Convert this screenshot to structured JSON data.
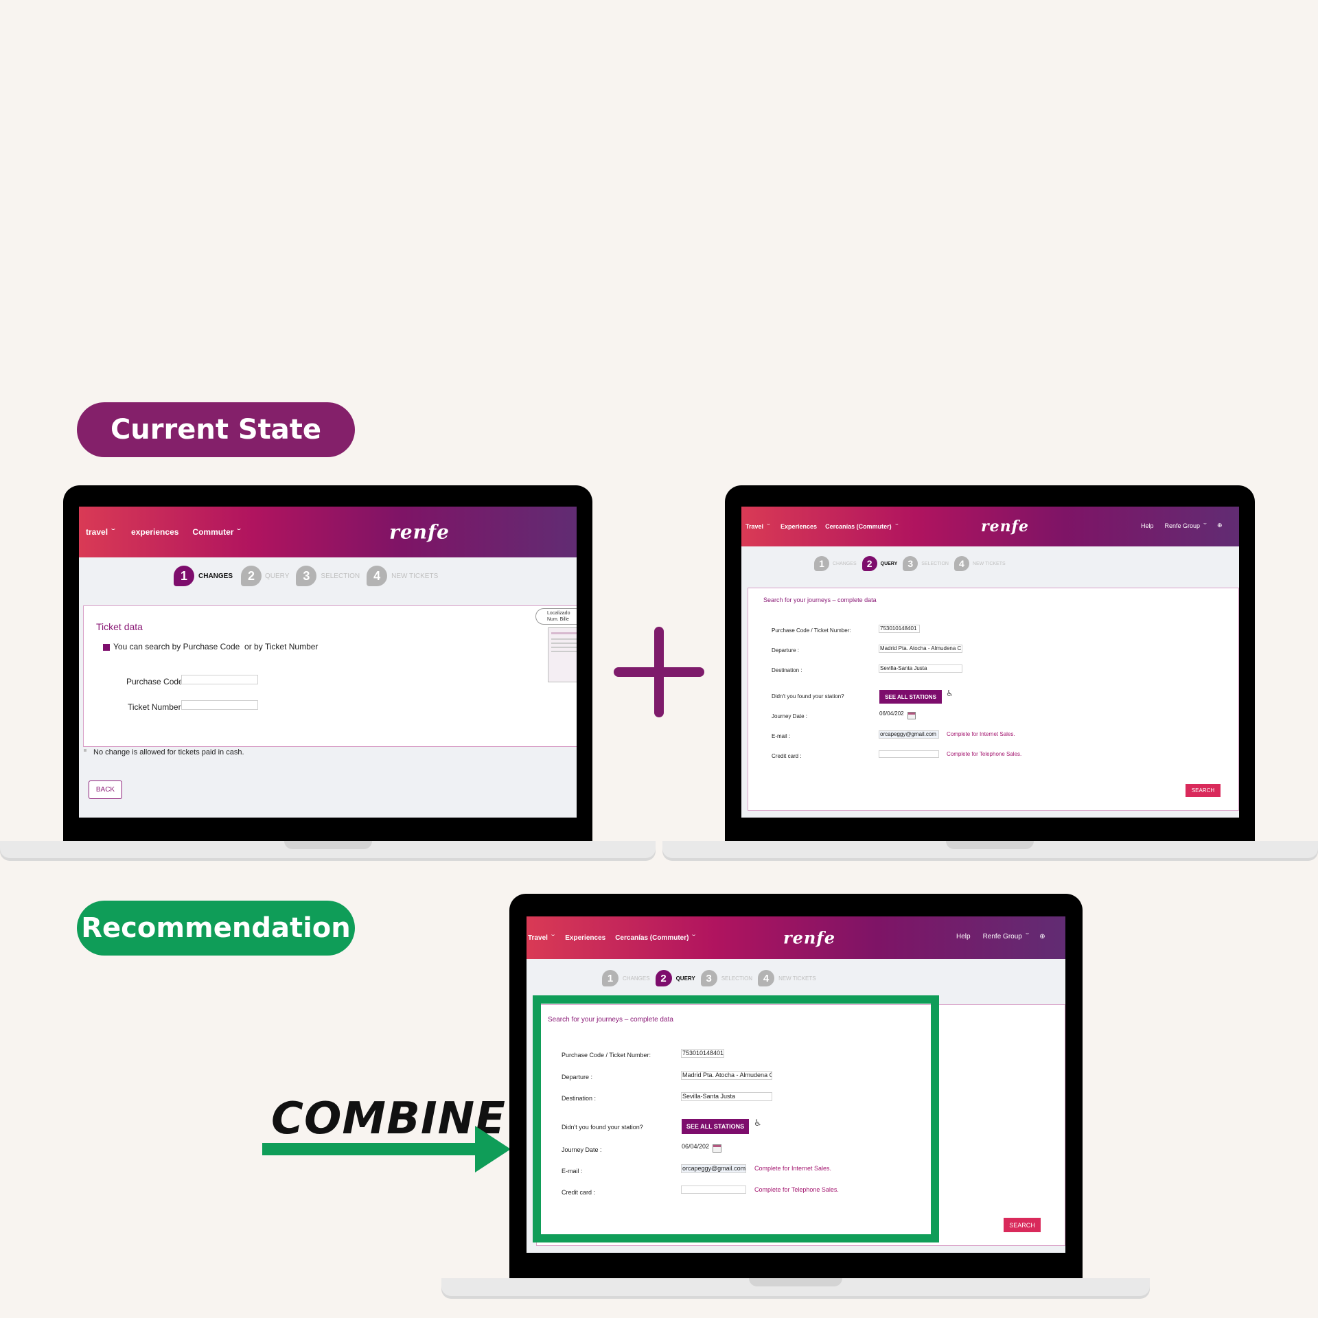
{
  "labels": {
    "current_state": "Current State",
    "recommendation": "Recommendation",
    "combine": "COMBINE"
  },
  "colors": {
    "background": "#f8f4f0",
    "current_pill": "#84206a",
    "recommendation_pill": "#0f9d58",
    "plus": "#7e1b6b",
    "arrow": "#0f9d58",
    "highlight": "#0f9d58",
    "renfe_purple": "#7d0d6c",
    "search_red": "#d92a5b"
  },
  "icons": {
    "plus": "plus-icon",
    "arrow": "right-arrow-icon",
    "calendar": "calendar-icon",
    "wheelchair": "wheelchair-icon",
    "globe": "globe-icon"
  },
  "screen1": {
    "nav": {
      "travel": "travel",
      "experiences": "experiences",
      "commuter": "Commuter",
      "logo": "renfe"
    },
    "steps": [
      "CHANGES",
      "QUERY",
      "SELECTION",
      "NEW TICKETS"
    ],
    "step_numbers": [
      "1",
      "2",
      "3",
      "4"
    ],
    "active_step": 1,
    "ticket_data_title": "Ticket data",
    "search_hint": {
      "prefix": "You can search by",
      "purchase_code": "Purchase Code",
      "or_by": "or by",
      "ticket_number": "Ticket Number"
    },
    "purchase_code_label": "Purchase Code:",
    "ticket_number_label": "Ticket Number:",
    "purchase_code_value": "",
    "ticket_number_value": "",
    "ticket_image_text_1": "Localizado",
    "ticket_image_text_2": "Num. Bille",
    "notice": "No change is allowed for tickets paid in cash.",
    "back_button": "BACK"
  },
  "screen2": {
    "nav": {
      "travel": "Travel",
      "experiences": "Experiences",
      "commuter": "Cercanías (Commuter)",
      "logo": "renfe",
      "help": "Help",
      "group": "Renfe Group"
    },
    "steps": [
      "CHANGES",
      "QUERY",
      "SELECTION",
      "NEW TICKETS"
    ],
    "step_numbers": [
      "1",
      "2",
      "3",
      "4"
    ],
    "active_step": 2,
    "form_title": "Search for your journeys – complete data",
    "fields": {
      "code_label": "Purchase Code / Ticket Number:",
      "code_value": "753010148401",
      "departure_label": "Departure :",
      "departure_value": "Madrid Pta. Atocha - Almudena C",
      "destination_label": "Destination :",
      "destination_value": "Sevilla-Santa Justa",
      "not_found_label": "Didn't you found your station?",
      "see_all_stations": "SEE ALL STATIONS",
      "date_label": "Journey Date :",
      "date_value": "06/04/202",
      "email_label": "E-mail :",
      "email_value": "orcapeggy@gmail.com",
      "email_link": "Complete for Internet Sales.",
      "card_label": "Credit card :",
      "card_value": "",
      "card_link": "Complete for Telephone Sales."
    },
    "search_button": "SEARCH"
  }
}
